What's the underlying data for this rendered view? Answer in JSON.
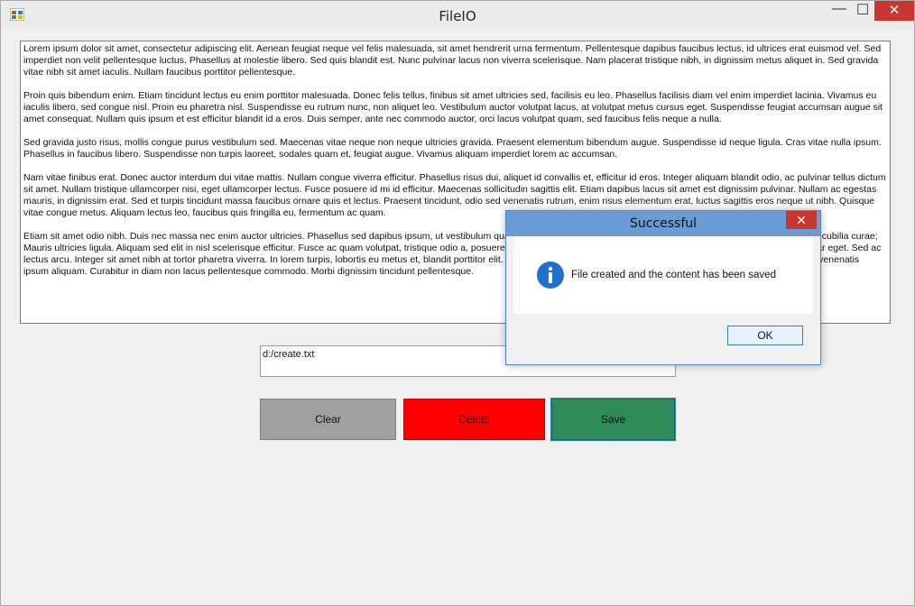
{
  "window": {
    "title": "FileIO",
    "minimize": "—",
    "maximize": "☐",
    "close": "✕"
  },
  "editor": {
    "paragraphs": [
      "Lorem ipsum dolor sit amet, consectetur adipiscing elit. Aenean feugiat neque vel felis malesuada, sit amet hendrerit urna fermentum. Pellentesque dapibus faucibus lectus, id ultrices erat euismod vel. Sed imperdiet non velit pellentesque luctus. Phasellus at molestie libero. Sed quis blandit est. Nunc pulvinar lacus non viverra scelerisque. Nam placerat tristique nibh, in dignissim metus aliquet in. Sed gravida vitae nibh sit amet iaculis. Nullam faucibus porttitor pellentesque.",
      "Proin quis bibendum enim. Etiam tincidunt lectus eu enim porttitor malesuada. Donec felis tellus, finibus sit amet ultricies sed, facilisis eu leo. Phasellus facilisis diam vel enim imperdiet lacinia. Vivamus eu iaculis libero, sed congue nisl. Proin eu pharetra nisl. Suspendisse eu rutrum nunc, non aliquet leo. Vestibulum auctor volutpat lacus, at volutpat metus cursus eget. Suspendisse feugiat accumsan augue sit amet consequat. Nullam quis ipsum et est efficitur blandit id a eros. Duis semper, ante nec commodo auctor, orci lacus volutpat quam, sed faucibus felis neque a nulla.",
      "Sed gravida justo risus, mollis congue purus vestibulum sed. Maecenas vitae neque non neque ultricies gravida. Praesent elementum bibendum augue. Suspendisse id neque ligula. Cras vitae nulla ipsum. Phasellus in faucibus libero. Suspendisse non turpis laoreet, sodales quam et, feugiat augue. Vivamus aliquam imperdiet lorem ac accumsan.",
      "Nam vitae finibus erat. Donec auctor interdum dui vitae mattis. Nullam congue viverra efficitur. Phasellus risus dui, aliquet id convallis et, efficitur id eros. Integer aliquam blandit odio, ac pulvinar tellus dictum sit amet. Nullam tristique ullamcorper nisi, eget ullamcorper lectus. Fusce posuere id mi id efficitur. Maecenas sollicitudin sagittis elit. Etiam dapibus lacus sit amet est dignissim pulvinar. Nullam ac egestas mauris, in dignissim erat. Sed et turpis tincidunt massa faucibus ornare quis et lectus. Praesent tincidunt, odio sed venenatis rutrum, enim risus elementum erat, luctus sagittis eros neque ut nibh. Quisque vitae congue metus. Aliquam lectus leo, faucibus quis fringilla eu, fermentum ac quam.",
      "Etiam sit amet odio nibh. Duis nec massa nec enim auctor ultricies. Phasellus sed dapibus ipsum, ut vestibulum quam. Vestibulum ante ipsum primis in faucibus orci luctus et ultrices posuere cubilia curae; Mauris ultricies ligula. Aliquam sed elit in nisl scelerisque efficitur. Fusce ac quam volutpat, tristique odio a, posuere justo. Vivamus ullamcorper rhoncus lectus, vitae pellentesque justo pulvinar eget. Sed ac lectus arcu. Integer sit amet nibh at tortor pharetra viverra. In lorem turpis, lobortis eu metus et, blandit porttitor elit. Cras ornare suscipit finibus. Vestibulum cursus turpis sit amet mi porta, ac venenatis ipsum aliquam. Curabitur in diam non lacus pellentesque commodo. Morbi dignissim tincidunt pellentesque."
    ]
  },
  "path_input": {
    "value": "d:/create.txt"
  },
  "buttons": {
    "clear": "Clear",
    "delete": "Delete",
    "save": "Save"
  },
  "dialog": {
    "title": "Successful",
    "close": "✕",
    "message": "File created and the content has been saved",
    "ok": "OK",
    "icon": "info-icon"
  },
  "colors": {
    "clear": "#a0a0a0",
    "delete": "#ff0000",
    "save": "#2e8b57",
    "dialog_title": "#6b9bd6",
    "close": "#c7372f"
  }
}
